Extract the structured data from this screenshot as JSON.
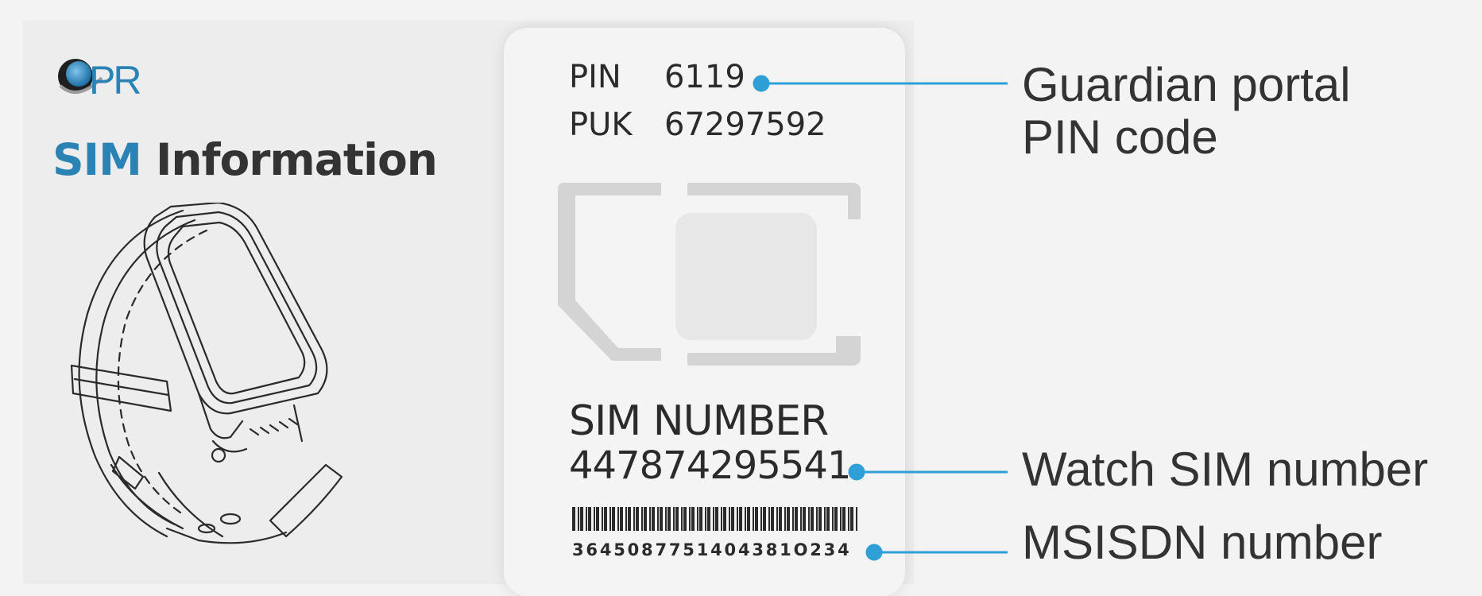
{
  "logo": {
    "text": "PR"
  },
  "heading": {
    "accent": "SIM",
    "rest": "Information"
  },
  "sim_card": {
    "pin_label": "PIN",
    "pin_value": "6119",
    "puk_label": "PUK",
    "puk_value": "67297592",
    "sim_number_label": "SIM NUMBER",
    "sim_number_value": "447874295541",
    "barcode_digits": "3645087751404381O234"
  },
  "callouts": {
    "pin": "Guardian portal\nPIN code",
    "sim_number": "Watch SIM number",
    "msisdn": "MSISDN number"
  },
  "colors": {
    "accent_blue": "#2a83b4",
    "callout_blue": "#2f9fd8",
    "text_dark": "#333333"
  }
}
